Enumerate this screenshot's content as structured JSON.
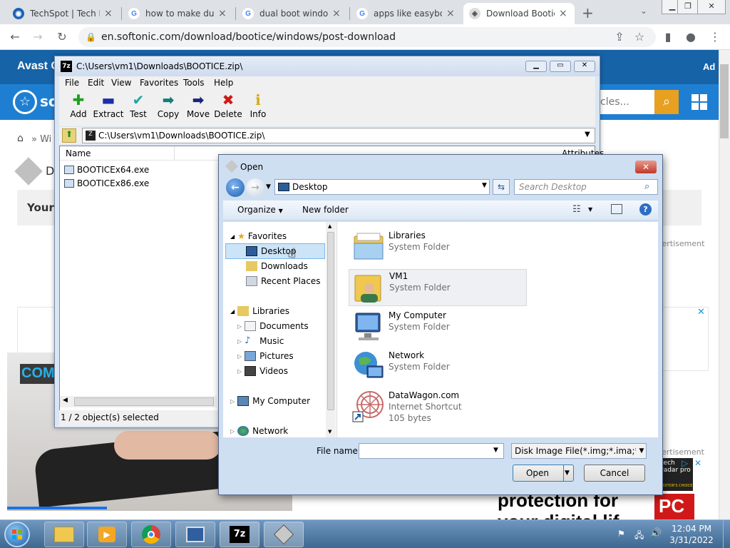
{
  "browser": {
    "tabs": [
      {
        "title": "TechSpot | Tech Er",
        "favicon": "techspot-icon"
      },
      {
        "title": "how to make dua",
        "favicon": "google-icon"
      },
      {
        "title": "dual boot windov",
        "favicon": "google-icon"
      },
      {
        "title": "apps like easybcd",
        "favicon": "google-icon"
      },
      {
        "title": "Download Bootice",
        "favicon": "softonic-icon"
      }
    ],
    "url": "en.softonic.com/download/bootice/windows/post-download"
  },
  "page": {
    "avast_text": "Avast C",
    "ad_text": "Ad",
    "search_placeholder_fragment": "cles...",
    "breadcrumb_fragment": "Wi",
    "heading_fragment": "D",
    "your_fragment": "Your",
    "advertisement_label": "vertisement",
    "advertisement_label2": "ertisement",
    "con_text": "COM",
    "protection_text": "protection for",
    "lifes_text": "your digital lif",
    "brand_logo": "tech radar pro",
    "brand_sub": "EDITOR'S CHOICE",
    "pc_text": "PC"
  },
  "zip": {
    "title": "C:\\Users\\vm1\\Downloads\\BOOTICE.zip\\",
    "menu": [
      "File",
      "Edit",
      "View",
      "Favorites",
      "Tools",
      "Help"
    ],
    "tools": [
      {
        "label": "Add",
        "icon": "plus-icon",
        "color": "#1ea01e"
      },
      {
        "label": "Extract",
        "icon": "minus-icon",
        "color": "#1a2ea8"
      },
      {
        "label": "Test",
        "icon": "check-icon",
        "color": "#1aa6a6"
      },
      {
        "label": "Copy",
        "icon": "arrow-right-icon",
        "color": "#147c7c"
      },
      {
        "label": "Move",
        "icon": "arrow-right-icon",
        "color": "#1a2478"
      },
      {
        "label": "Delete",
        "icon": "x-icon",
        "color": "#d01818"
      },
      {
        "label": "Info",
        "icon": "info-icon",
        "color": "#d4a81a"
      }
    ],
    "address": "C:\\Users\\vm1\\Downloads\\BOOTICE.zip\\",
    "columns": {
      "name": "Name",
      "attributes": "Attributes"
    },
    "files": [
      "BOOTICEx64.exe",
      "BOOTICEx86.exe"
    ],
    "status": "1 / 2 object(s) selected"
  },
  "dialog": {
    "title": "Open",
    "location": "Desktop",
    "search_placeholder": "Search Desktop",
    "organize": "Organize",
    "new_folder": "New folder",
    "nav": {
      "favorites": "Favorites",
      "desktop": "Desktop",
      "downloads": "Downloads",
      "recent": "Recent Places",
      "libraries": "Libraries",
      "documents": "Documents",
      "music": "Music",
      "pictures": "Pictures",
      "videos": "Videos",
      "computer": "My Computer",
      "network": "Network"
    },
    "items": [
      {
        "name": "Libraries",
        "type": "System Folder",
        "size": "",
        "icon": "libraries-folder-icon"
      },
      {
        "name": "VM1",
        "type": "System Folder",
        "size": "",
        "icon": "user-folder-icon"
      },
      {
        "name": "My Computer",
        "type": "System Folder",
        "size": "",
        "icon": "computer-icon"
      },
      {
        "name": "Network",
        "type": "System Folder",
        "size": "",
        "icon": "network-icon"
      },
      {
        "name": "DataWagon.com",
        "type": "Internet Shortcut",
        "size": "105 bytes",
        "icon": "internet-shortcut-icon"
      }
    ],
    "filename_label": "File name:",
    "filename_value": "",
    "filter": "Disk Image File(*.img;*.ima;*.vh",
    "open_button": "Open",
    "cancel_button": "Cancel"
  },
  "taskbar": {
    "time": "12:04 PM",
    "date": "3/31/2022",
    "apps": [
      "explorer-icon",
      "media-player-icon",
      "chrome-icon",
      "computer-icon",
      "7zip-icon",
      "bootice-icon"
    ],
    "zip_label": "7z"
  }
}
